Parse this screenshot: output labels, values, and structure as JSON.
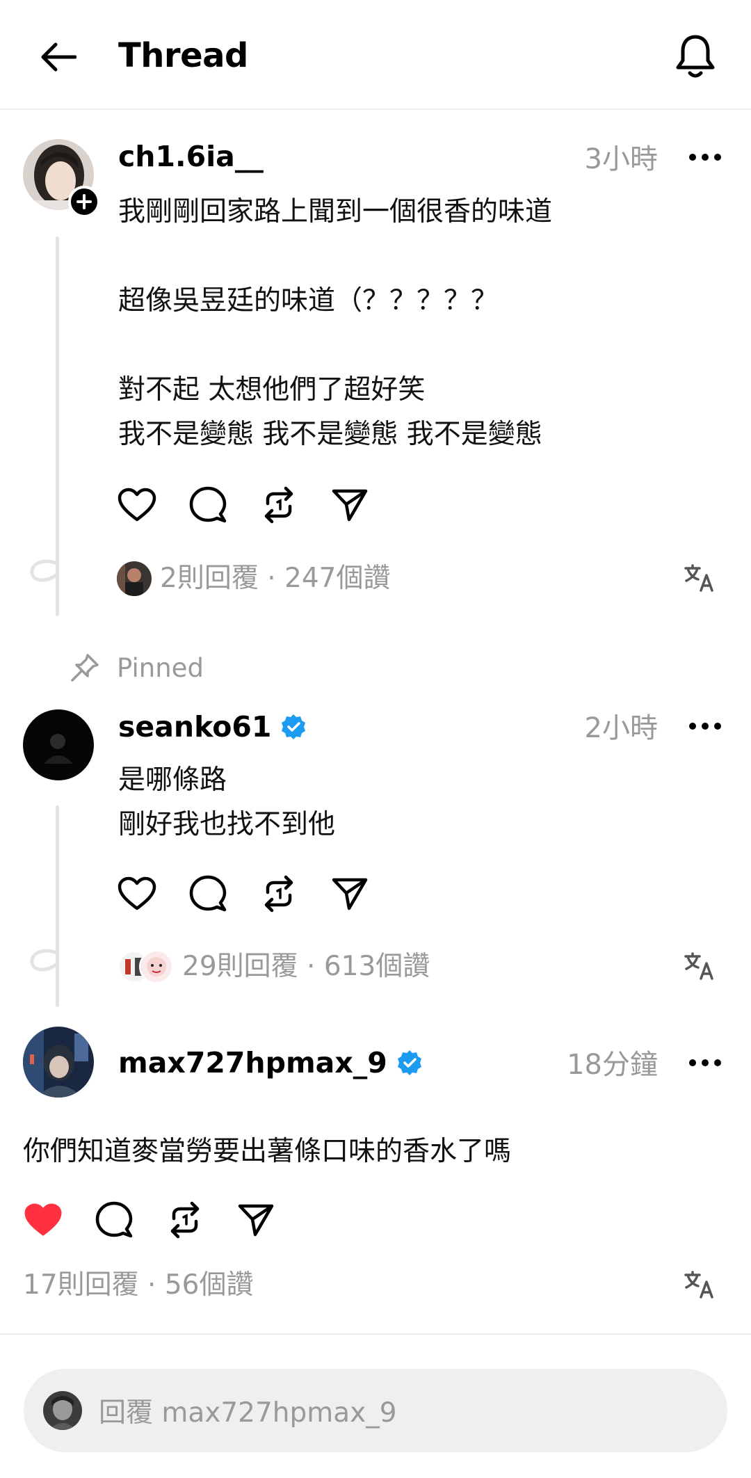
{
  "header": {
    "title": "Thread"
  },
  "posts": [
    {
      "username": "ch1.6ia__",
      "time": "3小時",
      "text": "我剛剛回家路上聞到一個很香的味道\n\n超像吳昱廷的味道（？？？？？\n\n對不起 太想他們了超好笑\n我不是變態 我不是變態 我不是變態",
      "stats": "2則回覆 · 247個讚",
      "liked": false
    },
    {
      "pinned_label": "Pinned",
      "username": "seanko61",
      "verified": true,
      "time": "2小時",
      "text": "是哪條路\n剛好我也找不到他",
      "stats": "29則回覆 · 613個讚",
      "liked": false
    },
    {
      "username": "max727hpmax_9",
      "verified": true,
      "time": "18分鐘",
      "text": "你們知道麥當勞要出薯條口味的香水了嗎",
      "stats": "17則回覆 · 56個讚",
      "liked": true
    }
  ],
  "reply_bar": {
    "placeholder": "回覆 max727hpmax_9"
  },
  "colors": {
    "like_active": "#ff3040",
    "verified": "#1d9bf0",
    "muted_text": "#999999"
  }
}
